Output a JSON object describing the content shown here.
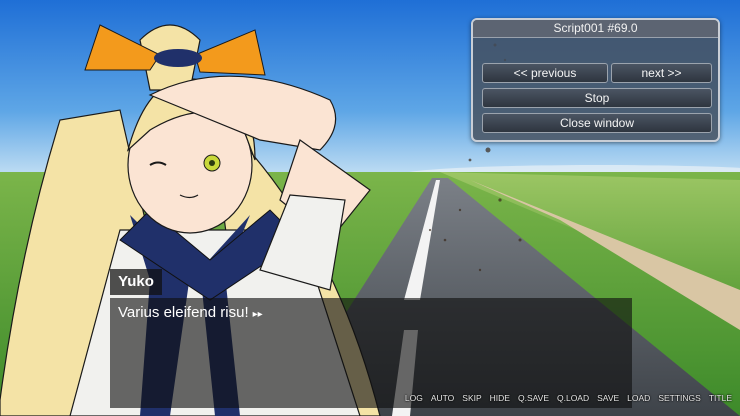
{
  "debug_window": {
    "title": "Script001 #69.0",
    "previous_label": "<< previous",
    "next_label": "next >>",
    "stop_label": "Stop",
    "close_label": "Close window"
  },
  "dialogue": {
    "speaker": "Yuko",
    "text": "Varius eleifend risu!",
    "continue_icon": "double-triangle-arrow"
  },
  "quick_menu": [
    "LOG",
    "AUTO",
    "SKIP",
    "HIDE",
    "Q.SAVE",
    "Q.LOAD",
    "SAVE",
    "LOAD",
    "SETTINGS",
    "TITLE"
  ],
  "colors": {
    "sky": "#2f7fd8",
    "grass": "#5fa03a",
    "road": "#5a5f66",
    "hair": "#f4e3a6",
    "ribbon": "#f39a1c",
    "uniform_navy": "#20306a"
  }
}
